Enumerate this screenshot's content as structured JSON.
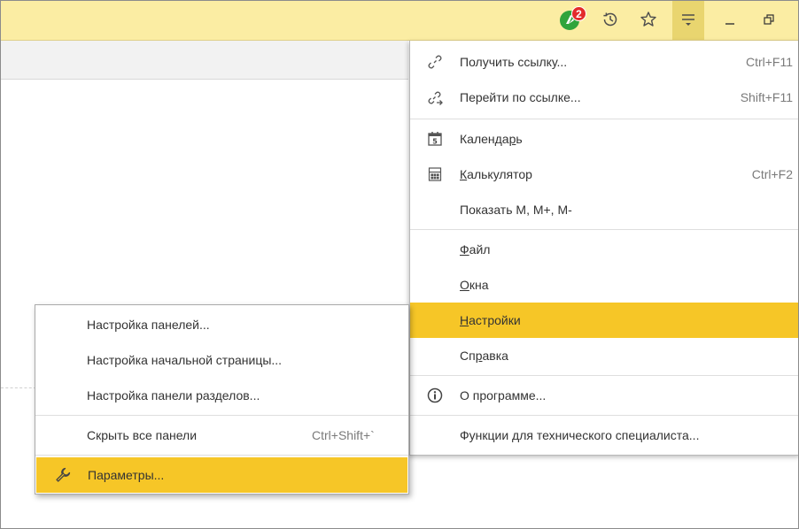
{
  "topbar": {
    "notification_count": "2",
    "icons": [
      "notifications-icon",
      "history-icon",
      "star-icon",
      "main-menu-icon",
      "minimize-icon",
      "restore-icon"
    ]
  },
  "main_menu": {
    "items": [
      {
        "label": "Получить ссылку...",
        "shortcut": "Ctrl+F11",
        "icon": "link-icon"
      },
      {
        "label": "Перейти по ссылке...",
        "shortcut": "Shift+F11",
        "icon": "go-link-icon"
      },
      {
        "label": "Календарь",
        "shortcut": "",
        "icon": "calendar-icon",
        "cal_day": "5"
      },
      {
        "label": "Калькулятор",
        "shortcut": "Ctrl+F2",
        "icon": "calculator-icon"
      },
      {
        "label": "Показать М, М+, М-",
        "shortcut": ""
      },
      {
        "label": "Файл",
        "shortcut": ""
      },
      {
        "label": "Окна",
        "shortcut": ""
      },
      {
        "label": "Настройки",
        "shortcut": "",
        "highlighted": true
      },
      {
        "label": "Справка",
        "shortcut": ""
      },
      {
        "label": "О программе...",
        "shortcut": "",
        "icon": "info-icon"
      },
      {
        "label": "Функции для технического специалиста...",
        "shortcut": ""
      }
    ]
  },
  "sub_menu": {
    "items": [
      {
        "label": "Настройка панелей...",
        "shortcut": ""
      },
      {
        "label": "Настройка начальной страницы...",
        "shortcut": ""
      },
      {
        "label": "Настройка панели разделов...",
        "shortcut": ""
      },
      {
        "label": "Скрыть все панели",
        "shortcut": "Ctrl+Shift+`"
      },
      {
        "label": "Параметры...",
        "shortcut": "",
        "icon": "wrench-icon",
        "highlighted": true
      }
    ]
  },
  "colors": {
    "topbar": "#fbeda3",
    "highlight": "#f6c627",
    "badge": "#e32b2b",
    "notification_icon": "#2fa43b"
  }
}
